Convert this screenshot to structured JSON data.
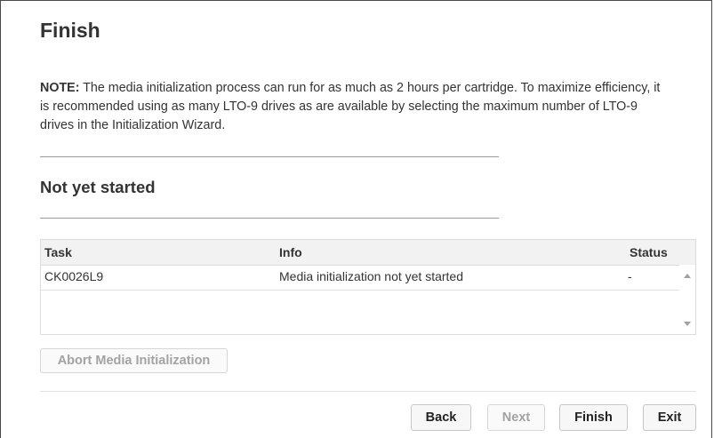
{
  "page": {
    "title": "Finish"
  },
  "note": {
    "prefix": "NOTE:",
    "text": " The media initialization process can run for as much as 2 hours per cartridge. To maximize efficiency, it is recommended using as many LTO-9 drives as are available by selecting the maximum number of LTO-9 drives in the Initialization Wizard."
  },
  "section": {
    "title": "Not yet started"
  },
  "table": {
    "headers": {
      "task": "Task",
      "info": "Info",
      "status": "Status"
    },
    "rows": [
      {
        "task": "CK0026L9",
        "info": "Media initialization not yet started",
        "status": "-"
      }
    ]
  },
  "buttons": {
    "abort": "Abort Media Initialization",
    "back": "Back",
    "next": "Next",
    "finish": "Finish",
    "exit": "Exit"
  }
}
